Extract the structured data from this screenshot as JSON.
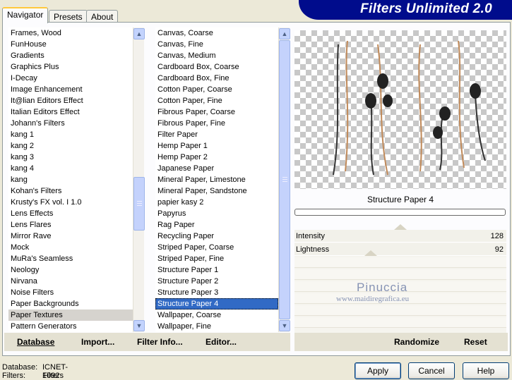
{
  "tabs": [
    {
      "label": "Navigator"
    },
    {
      "label": "Presets"
    },
    {
      "label": "About"
    }
  ],
  "banner": {
    "title": "Filters Unlimited 2.0"
  },
  "categories": {
    "items": [
      "Frames, Wood",
      "FunHouse",
      "Gradients",
      "Graphics Plus",
      "I-Decay",
      "Image Enhancement",
      "It@lian Editors Effect",
      "Italian Editors Effect",
      "Johann's Filters",
      "kang 1",
      "kang 2",
      "kang 3",
      "kang 4",
      "kang",
      "Kohan's Filters",
      "Krusty's FX vol. I 1.0",
      "Lens Effects",
      "Lens Flares",
      "Mirror Rave",
      "Mock",
      "MuRa's Seamless",
      "Neology",
      "Nirvana",
      "Noise Filters",
      "Paper Backgrounds",
      "Paper Textures",
      "Pattern Generators"
    ],
    "selected": "Paper Textures"
  },
  "filters": {
    "items": [
      "Canvas, Coarse",
      "Canvas, Fine",
      "Canvas, Medium",
      "Cardboard Box, Coarse",
      "Cardboard Box, Fine",
      "Cotton Paper, Coarse",
      "Cotton Paper, Fine",
      "Fibrous Paper, Coarse",
      "Fibrous Paper, Fine",
      "Filter Paper",
      "Hemp Paper 1",
      "Hemp Paper 2",
      "Japanese Paper",
      "Mineral Paper, Limestone",
      "Mineral Paper, Sandstone",
      "papier kasy 2",
      "Papyrus",
      "Rag Paper",
      "Recycling Paper",
      "Striped Paper, Coarse",
      "Striped Paper, Fine",
      "Structure Paper 1",
      "Structure Paper 2",
      "Structure Paper 3",
      "Structure Paper 4",
      "Wallpaper, Coarse",
      "Wallpaper, Fine"
    ],
    "selected": "Structure Paper 4"
  },
  "preview": {
    "filter_name": "Structure Paper 4"
  },
  "params": [
    {
      "label": "Intensity",
      "value": "128",
      "level": 0.5
    },
    {
      "label": "Lightness",
      "value": "92",
      "level": 0.36
    }
  ],
  "watermark": {
    "name": "Pinuccia",
    "url": "www.maidiregrafica.eu"
  },
  "left_toolbar": {
    "database": "Database",
    "import": "Import...",
    "filter_info": "Filter Info...",
    "editor": "Editor..."
  },
  "right_toolbar": {
    "randomize": "Randomize",
    "reset": "Reset"
  },
  "status": {
    "database_label": "Database:",
    "database_value": "ICNET-Filters",
    "filters_label": "Filters:",
    "filters_value": "1092"
  },
  "buttons": {
    "apply": "Apply",
    "cancel": "Cancel",
    "help": "Help"
  },
  "colors": {
    "banner": "#000c8c",
    "selection": "#316ac5",
    "category_selection": "#d6d3ce"
  }
}
